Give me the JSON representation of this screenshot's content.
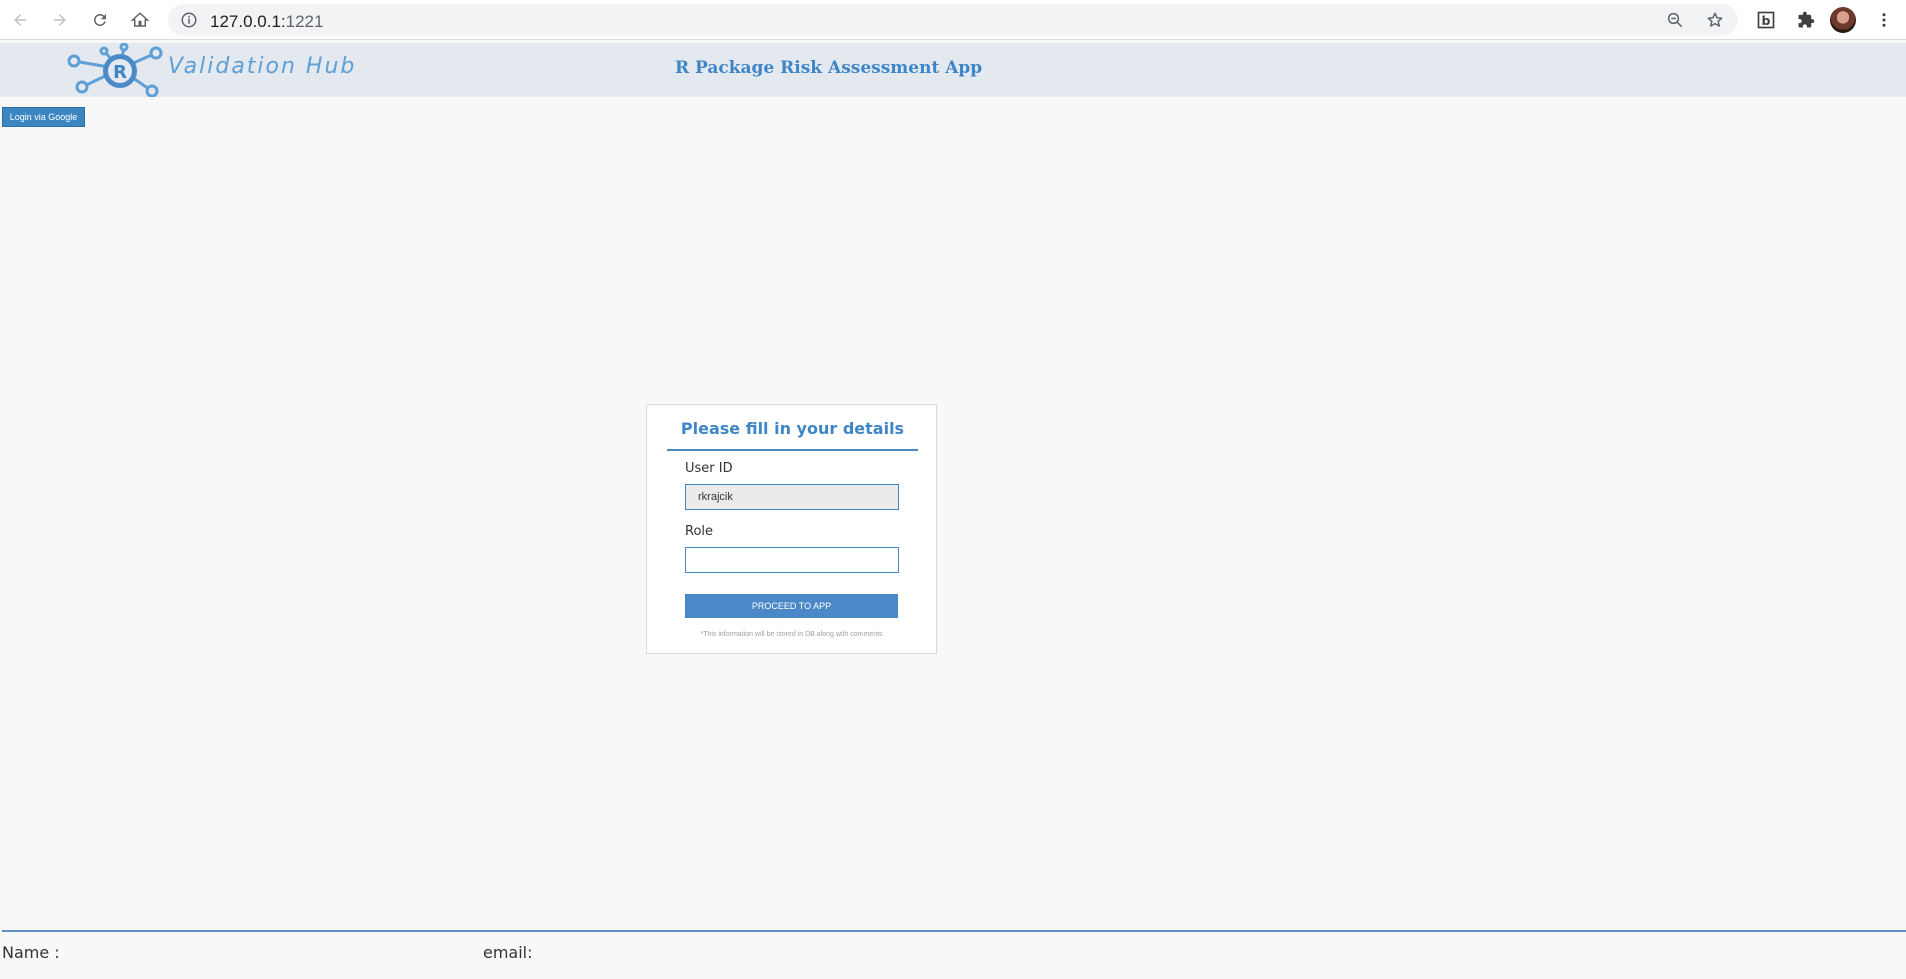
{
  "browser": {
    "url_host": "127.0.0.1:",
    "url_port": "1221",
    "icons": {
      "back": "arrow-left-icon",
      "forward": "arrow-right-icon",
      "reload": "reload-icon",
      "home": "home-icon",
      "site_info": "info-icon",
      "zoom": "zoom-out-icon",
      "bookmark": "star-icon",
      "extension_b": "b-extension-icon",
      "extensions": "puzzle-icon",
      "menu": "kebab-menu-icon"
    }
  },
  "header": {
    "logo_text": "Validation Hub",
    "logo_letter": "R",
    "title": "R Package Risk Assessment App"
  },
  "login_button": "Login via Google",
  "form": {
    "title": "Please fill in your details",
    "user_id_label": "User ID",
    "user_id_value": "rkrajcik",
    "role_label": "Role",
    "role_value": "",
    "proceed_label": "PROCEED TO APP",
    "note": "*This information will be stored in DB along with comments"
  },
  "footer": {
    "name_label": "Name :",
    "email_label": "email:"
  },
  "colors": {
    "accent": "#3f86c8",
    "header_bg": "#e3e9ee",
    "page_bg": "#f8f8f8"
  }
}
